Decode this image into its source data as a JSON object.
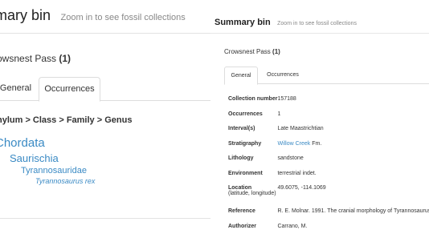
{
  "title": "Summary bin",
  "hint": "Zoom in to see fossil collections",
  "left_title": "mary bin",
  "left_place": {
    "name": "owsnest Pass",
    "count": "(1)"
  },
  "left_tabs": {
    "general": "General",
    "occurrences": "Occurrences"
  },
  "left_path": "hylum > Class > Family > Genus",
  "taxa": {
    "phylum": "Chordata",
    "class": "Saurischia",
    "family": "Tyrannosauridae",
    "genus": "Tyrannosaurus rex"
  },
  "place": {
    "name": "Crowsnest Pass",
    "count": "(1)"
  },
  "tabs": {
    "general": "General",
    "occurrences": "Occurrences"
  },
  "details": {
    "collection_number": {
      "label": "Collection number",
      "value": "157188"
    },
    "occurrences": {
      "label": "Occurrences",
      "value": "1"
    },
    "interval": {
      "label": "Interval(s)",
      "value": "Late Maastrichtian"
    },
    "stratigraphy": {
      "label": "Stratigraphy",
      "link": "Willow Creek",
      "suffix": "Fm."
    },
    "lithology": {
      "label": "Lithology",
      "value": "sandstone"
    },
    "environment": {
      "label": "Environment",
      "value": "terrestrial indet."
    },
    "location": {
      "label": "Location",
      "sublabel": "(latitude, longitude)",
      "value": "49.6075, -114.1069"
    },
    "reference": {
      "label": "Reference",
      "value": "R. E. Molnar. 1991. The cranial morphology of Tyrannosaurus"
    },
    "authorizer": {
      "label": "Authorizer",
      "value": "Carrano, M."
    }
  }
}
